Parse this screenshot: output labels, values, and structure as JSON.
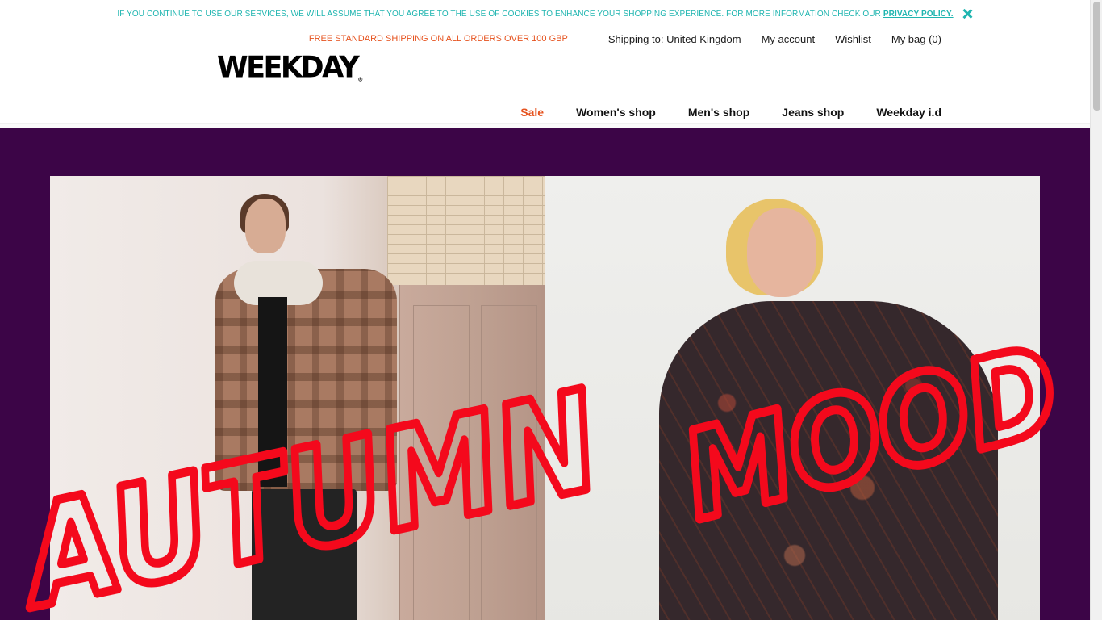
{
  "cookie_bar": {
    "message": "IF YOU CONTINUE TO USE OUR SERVICES, WE WILL ASSUME THAT YOU AGREE TO THE USE OF COOKIES TO ENHANCE YOUR SHOPPING EXPERIENCE. FOR MORE INFORMATION CHECK OUR",
    "link": "PRIVACY POLICY.",
    "close_icon": "close-icon",
    "color": "#1fb5b0"
  },
  "utility": {
    "promo": "FREE STANDARD SHIPPING ON ALL ORDERS OVER 100 GBP",
    "shipping": "Shipping to: United Kingdom",
    "account": "My account",
    "wishlist": "Wishlist",
    "bag": "My bag (0)",
    "promo_color": "#e6531f"
  },
  "brand": {
    "logo": "WEEKDAY",
    "registered": "®"
  },
  "nav": {
    "items": [
      {
        "label": "Sale"
      },
      {
        "label": "Women's shop"
      },
      {
        "label": "Men's shop"
      },
      {
        "label": "Jeans shop"
      },
      {
        "label": "Weekday i.d"
      }
    ],
    "sale_color": "#e6531f"
  },
  "hero": {
    "handwriting_left": "AUTUMN",
    "handwriting_right": "MOOD",
    "background": "#3c0547",
    "ink_color": "#f4091c"
  }
}
